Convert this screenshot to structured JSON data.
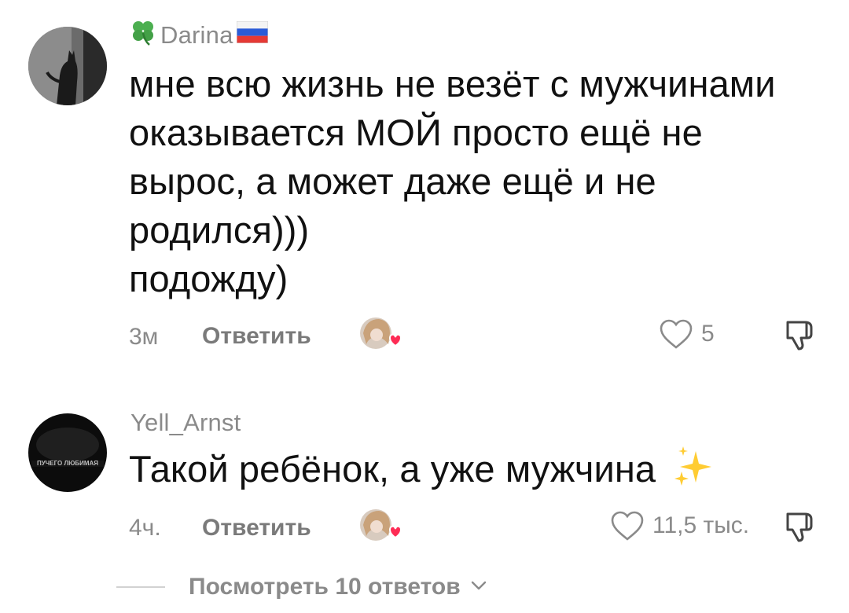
{
  "comments": [
    {
      "username": "Darina",
      "username_prefix_icon": "four-leaf-clover-emoji",
      "username_suffix_icon": "russia-flag-emoji",
      "text": "мне всю жизнь не везёт с мужчинами\nоказывается МОЙ просто ещё не\nвырос, а может даже ещё и не\nродился)))\nподожду)",
      "time": "3м",
      "reply_label": "Ответить",
      "likes": "5",
      "liked_by_creator": true
    },
    {
      "username": "Yell_Arnst",
      "text": "Такой ребёнок, а уже мужчина",
      "text_suffix_icon": "sparkles-emoji",
      "time": "4ч.",
      "reply_label": "Ответить",
      "likes": "11,5 тыс.",
      "liked_by_creator": true
    }
  ],
  "view_replies_label": "Посмотреть 10 ответов",
  "colors": {
    "text": "#111111",
    "secondary": "#8a8a8a",
    "heart_badge": "#fe2c55"
  }
}
